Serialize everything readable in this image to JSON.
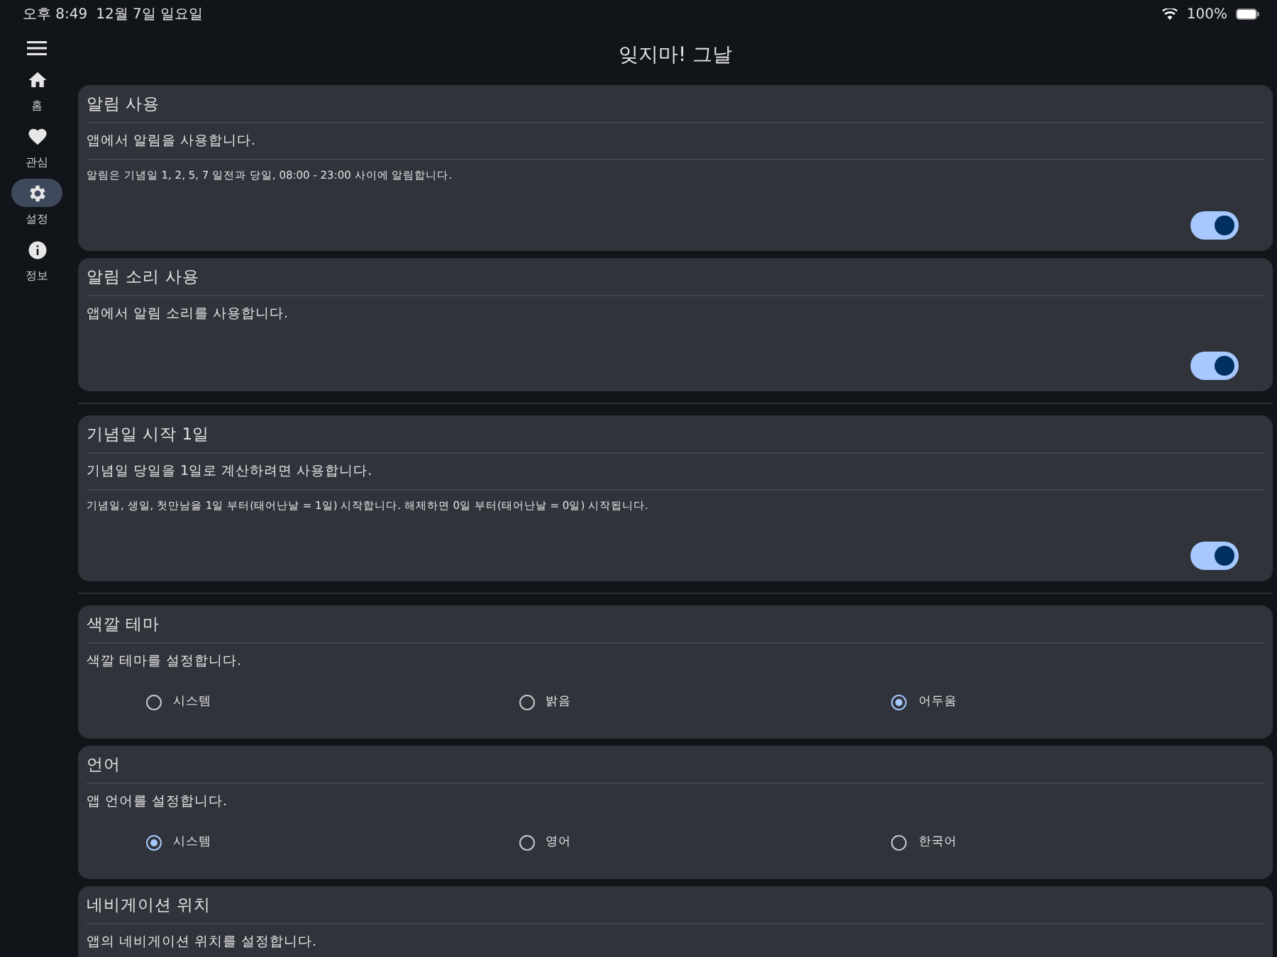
{
  "status_bar": {
    "time": "오후 8:49",
    "date": "12월 7일 일요일",
    "battery": "100%"
  },
  "sidebar": {
    "items": [
      {
        "kind": "home",
        "label": "홈",
        "selected": false
      },
      {
        "kind": "heart",
        "label": "관심",
        "selected": false
      },
      {
        "kind": "gear",
        "label": "설정",
        "selected": true
      },
      {
        "kind": "info",
        "label": "정보",
        "selected": false
      }
    ]
  },
  "title": "잊지마! 그날",
  "groups": [
    {
      "settings": [
        {
          "kind": "toggle",
          "title": "알림 사용",
          "description": "앱에서 알림을 사용합니다.",
          "note": "알림은 기념일 1, 2, 5, 7 일전과 당일, 08:00 - 23:00 사이에 알림합니다.",
          "on": true
        },
        {
          "kind": "toggle",
          "title": "알림 소리 사용",
          "description": "앱에서 알림 소리를 사용합니다.",
          "on": true
        }
      ]
    },
    {
      "settings": [
        {
          "kind": "toggle",
          "title": "기념일 시작 1일",
          "description": "기념일 당일을 1일로 계산하려면 사용합니다.",
          "note": "기념일, 생일, 첫만남을 1일 부터(태어난날 = 1일) 시작합니다. 해제하면 0일 부터(태어난날 = 0일) 시작됩니다.",
          "on": true
        }
      ]
    },
    {
      "settings": [
        {
          "kind": "radio",
          "title": "색깔 테마",
          "description": "색깔 테마를 설정합니다.",
          "options": [
            {
              "label": "시스템",
              "selected": false
            },
            {
              "label": "밝음",
              "selected": false
            },
            {
              "label": "어두움",
              "selected": true
            }
          ]
        },
        {
          "kind": "radio",
          "title": "언어",
          "description": "앱 언어를 설정합니다.",
          "options": [
            {
              "label": "시스템",
              "selected": true
            },
            {
              "label": "영어",
              "selected": false
            },
            {
              "label": "한국어",
              "selected": false
            }
          ]
        },
        {
          "kind": "plain",
          "title": "네비게이션 위치",
          "description": "앱의 네비게이션 위치를 설정합니다."
        }
      ]
    }
  ]
}
